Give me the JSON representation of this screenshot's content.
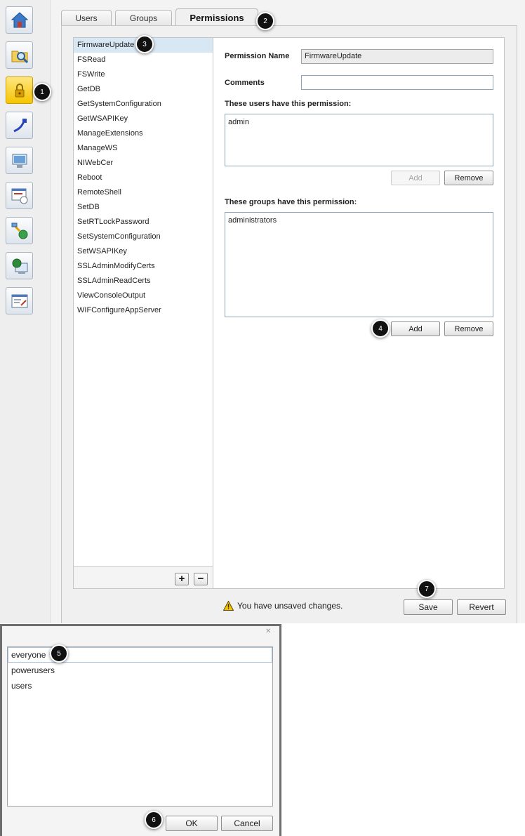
{
  "tabs": [
    {
      "label": "Users"
    },
    {
      "label": "Groups"
    },
    {
      "label": "Permissions"
    }
  ],
  "sidebar": {
    "items": [
      {
        "icon": "home-icon"
      },
      {
        "icon": "folder-search-icon"
      },
      {
        "icon": "lock-icon",
        "active": true
      },
      {
        "icon": "network-cable-icon"
      },
      {
        "icon": "computer-icon"
      },
      {
        "icon": "clock-settings-icon"
      },
      {
        "icon": "network-globe-icon"
      },
      {
        "icon": "web-server-icon"
      },
      {
        "icon": "console-window-icon"
      }
    ]
  },
  "markers": [
    "1",
    "2",
    "3",
    "4",
    "5",
    "6",
    "7"
  ],
  "permissions": {
    "selected_index": 0,
    "items": [
      "FirmwareUpdate",
      "FSRead",
      "FSWrite",
      "GetDB",
      "GetSystemConfiguration",
      "GetWSAPIKey",
      "ManageExtensions",
      "ManageWS",
      "NIWebCer",
      "Reboot",
      "RemoteShell",
      "SetDB",
      "SetRTLockPassword",
      "SetSystemConfiguration",
      "SetWSAPIKey",
      "SSLAdminModifyCerts",
      "SSLAdminReadCerts",
      "ViewConsoleOutput",
      "WIFConfigureAppServer"
    ],
    "add_symbol": "+",
    "remove_symbol": "−"
  },
  "details": {
    "name_label": "Permission Name",
    "name_value": "FirmwareUpdate",
    "comments_label": "Comments",
    "comments_value": "",
    "users_label": "These users have this permission:",
    "users": [
      "admin"
    ],
    "users_add": "Add",
    "users_remove": "Remove",
    "groups_label": "These groups have this permission:",
    "groups": [
      "administrators"
    ],
    "groups_add": "Add",
    "groups_remove": "Remove"
  },
  "footer": {
    "unsaved": "You have unsaved changes.",
    "save": "Save",
    "revert": "Revert"
  },
  "dialog": {
    "close_glyph": "✕",
    "items": [
      "everyone",
      "powerusers",
      "users"
    ],
    "selected_index": 0,
    "ok": "OK",
    "cancel": "Cancel"
  }
}
